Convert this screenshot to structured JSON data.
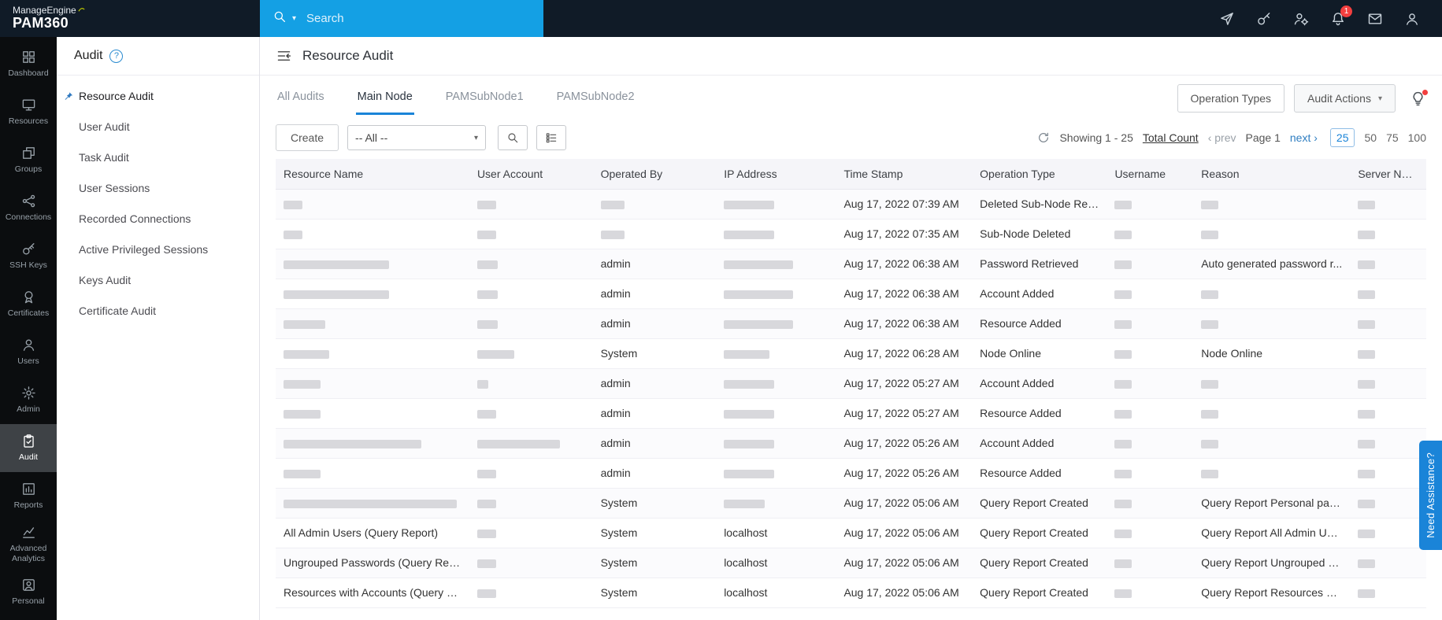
{
  "topbar": {
    "brand_line1": "ManageEngine",
    "brand_line2": "PAM360",
    "search": {
      "placeholder": "Search"
    },
    "icons": [
      {
        "id": "quick-send",
        "icon": "send-icon"
      },
      {
        "id": "resource-key",
        "icon": "key-icon"
      },
      {
        "id": "user-settings",
        "icon": "user-settings-icon"
      },
      {
        "id": "notifications",
        "icon": "bell-icon",
        "badge": "1"
      },
      {
        "id": "mail",
        "icon": "mail-icon"
      },
      {
        "id": "profile",
        "icon": "profile-icon"
      }
    ]
  },
  "sidebar": {
    "items": [
      {
        "id": "dashboard",
        "label": "Dashboard",
        "icon": "dashboard-icon",
        "active": false
      },
      {
        "id": "resources",
        "label": "Resources",
        "icon": "resources-icon",
        "active": false
      },
      {
        "id": "groups",
        "label": "Groups",
        "icon": "groups-icon",
        "active": false
      },
      {
        "id": "connections",
        "label": "Connections",
        "icon": "connections-icon",
        "active": false
      },
      {
        "id": "ssh-keys",
        "label": "SSH Keys",
        "icon": "ssh-keys-icon",
        "active": false
      },
      {
        "id": "certificates",
        "label": "Certificates",
        "icon": "certificates-icon",
        "active": false
      },
      {
        "id": "users",
        "label": "Users",
        "icon": "users-icon",
        "active": false
      },
      {
        "id": "admin",
        "label": "Admin",
        "icon": "admin-icon",
        "active": false
      },
      {
        "id": "audit",
        "label": "Audit",
        "icon": "audit-icon",
        "active": true
      },
      {
        "id": "reports",
        "label": "Reports",
        "icon": "reports-icon",
        "active": false
      },
      {
        "id": "advanced-analytics",
        "label": "Advanced Analytics",
        "icon": "analytics-icon",
        "active": false
      },
      {
        "id": "personal",
        "label": "Personal",
        "icon": "personal-icon",
        "active": false
      }
    ]
  },
  "subsidebar": {
    "title": "Audit",
    "items": [
      {
        "id": "resource-audit",
        "label": "Resource Audit",
        "active": true,
        "pinned": true
      },
      {
        "id": "user-audit",
        "label": "User Audit",
        "active": false,
        "pinned": false
      },
      {
        "id": "task-audit",
        "label": "Task Audit",
        "active": false,
        "pinned": false
      },
      {
        "id": "user-sessions",
        "label": "User Sessions",
        "active": false,
        "pinned": false
      },
      {
        "id": "recorded-connections",
        "label": "Recorded Connections",
        "active": false,
        "pinned": false
      },
      {
        "id": "active-privileged-sessions",
        "label": "Active Privileged Sessions",
        "active": false,
        "pinned": false
      },
      {
        "id": "keys-audit",
        "label": "Keys Audit",
        "active": false,
        "pinned": false
      },
      {
        "id": "certificate-audit",
        "label": "Certificate Audit",
        "active": false,
        "pinned": false
      }
    ]
  },
  "main": {
    "page_title": "Resource Audit",
    "tabs": [
      {
        "id": "all-audits",
        "label": "All Audits",
        "active": false
      },
      {
        "id": "main-node",
        "label": "Main Node",
        "active": true
      },
      {
        "id": "pamsubnode1",
        "label": "PAMSubNode1",
        "active": false
      },
      {
        "id": "pamsubnode2",
        "label": "PAMSubNode2",
        "active": false
      }
    ],
    "buttons": {
      "operation_types": "Operation Types",
      "audit_actions": "Audit Actions"
    },
    "toolbar": {
      "create": "Create",
      "filter_selected": "-- All --"
    },
    "pagination": {
      "showing": "Showing 1 - 25",
      "total_count": "Total Count",
      "prev": "prev",
      "page": "Page 1",
      "next": "next",
      "sizes": [
        "25",
        "50",
        "75",
        "100"
      ],
      "active_size": "25"
    },
    "table": {
      "columns": [
        "Resource Name",
        "User Account",
        "Operated By",
        "IP Address",
        "Time Stamp",
        "Operation Type",
        "Username",
        "Reason",
        "Server Name"
      ],
      "rows": [
        [
          {
            "redacted": 24
          },
          {
            "redacted": 24
          },
          {
            "redacted": 30
          },
          {
            "redacted": 64
          },
          {
            "text": "Aug 17, 2022 07:39 AM"
          },
          {
            "text": "Deleted Sub-Node Rest..."
          },
          {
            "redacted": 22
          },
          {
            "redacted": 22
          },
          {
            "redacted": 22
          }
        ],
        [
          {
            "redacted": 24
          },
          {
            "redacted": 24
          },
          {
            "redacted": 30
          },
          {
            "redacted": 64
          },
          {
            "text": "Aug 17, 2022 07:35 AM"
          },
          {
            "text": "Sub-Node Deleted"
          },
          {
            "redacted": 22
          },
          {
            "redacted": 22
          },
          {
            "redacted": 22
          }
        ],
        [
          {
            "redacted": 134
          },
          {
            "redacted": 26
          },
          {
            "text": "admin"
          },
          {
            "redacted": 88
          },
          {
            "text": "Aug 17, 2022 06:38 AM"
          },
          {
            "text": "Password Retrieved"
          },
          {
            "redacted": 22
          },
          {
            "text": "Auto generated password r..."
          },
          {
            "redacted": 22
          }
        ],
        [
          {
            "redacted": 134
          },
          {
            "redacted": 26
          },
          {
            "text": "admin"
          },
          {
            "redacted": 88
          },
          {
            "text": "Aug 17, 2022 06:38 AM"
          },
          {
            "text": "Account Added"
          },
          {
            "redacted": 22
          },
          {
            "redacted": 22
          },
          {
            "redacted": 22
          }
        ],
        [
          {
            "redacted": 53
          },
          {
            "redacted": 26
          },
          {
            "text": "admin"
          },
          {
            "redacted": 88
          },
          {
            "text": "Aug 17, 2022 06:38 AM"
          },
          {
            "text": "Resource Added"
          },
          {
            "redacted": 22
          },
          {
            "redacted": 22
          },
          {
            "redacted": 22
          }
        ],
        [
          {
            "redacted": 58
          },
          {
            "redacted": 47
          },
          {
            "text": "System"
          },
          {
            "redacted": 58
          },
          {
            "text": "Aug 17, 2022 06:28 AM"
          },
          {
            "text": "Node Online"
          },
          {
            "redacted": 22
          },
          {
            "text": "Node Online"
          },
          {
            "redacted": 22
          }
        ],
        [
          {
            "redacted": 47
          },
          {
            "redacted": 14
          },
          {
            "text": "admin"
          },
          {
            "redacted": 64
          },
          {
            "text": "Aug 17, 2022 05:27 AM"
          },
          {
            "text": "Account Added"
          },
          {
            "redacted": 22
          },
          {
            "redacted": 22
          },
          {
            "redacted": 22
          }
        ],
        [
          {
            "redacted": 47
          },
          {
            "redacted": 24
          },
          {
            "text": "admin"
          },
          {
            "redacted": 64
          },
          {
            "text": "Aug 17, 2022 05:27 AM"
          },
          {
            "text": "Resource Added"
          },
          {
            "redacted": 22
          },
          {
            "redacted": 22
          },
          {
            "redacted": 22
          }
        ],
        [
          {
            "redacted": 175
          },
          {
            "redacted": 105
          },
          {
            "text": "admin"
          },
          {
            "redacted": 64
          },
          {
            "text": "Aug 17, 2022 05:26 AM"
          },
          {
            "text": "Account Added"
          },
          {
            "redacted": 22
          },
          {
            "redacted": 22
          },
          {
            "redacted": 22
          }
        ],
        [
          {
            "redacted": 47
          },
          {
            "redacted": 24
          },
          {
            "text": "admin"
          },
          {
            "redacted": 64
          },
          {
            "text": "Aug 17, 2022 05:26 AM"
          },
          {
            "text": "Resource Added"
          },
          {
            "redacted": 22
          },
          {
            "redacted": 22
          },
          {
            "redacted": 22
          }
        ],
        [
          {
            "redacted": 220
          },
          {
            "redacted": 24
          },
          {
            "text": "System"
          },
          {
            "redacted": 52
          },
          {
            "text": "Aug 17, 2022 05:06 AM"
          },
          {
            "text": "Query Report Created"
          },
          {
            "redacted": 22
          },
          {
            "text": "Query Report Personal pass..."
          },
          {
            "redacted": 22
          }
        ],
        [
          {
            "text": "All Admin Users (Query Report)"
          },
          {
            "redacted": 24
          },
          {
            "text": "System"
          },
          {
            "text": "localhost"
          },
          {
            "text": "Aug 17, 2022 05:06 AM"
          },
          {
            "text": "Query Report Created"
          },
          {
            "redacted": 22
          },
          {
            "text": "Query Report All Admin Use..."
          },
          {
            "redacted": 22
          }
        ],
        [
          {
            "text": "Ungrouped Passwords (Query Report)"
          },
          {
            "redacted": 24
          },
          {
            "text": "System"
          },
          {
            "text": "localhost"
          },
          {
            "text": "Aug 17, 2022 05:06 AM"
          },
          {
            "text": "Query Report Created"
          },
          {
            "redacted": 22
          },
          {
            "text": "Query Report Ungrouped P..."
          },
          {
            "redacted": 22
          }
        ],
        [
          {
            "text": "Resources with Accounts (Query Re..."
          },
          {
            "redacted": 24
          },
          {
            "text": "System"
          },
          {
            "text": "localhost"
          },
          {
            "text": "Aug 17, 2022 05:06 AM"
          },
          {
            "text": "Query Report Created"
          },
          {
            "redacted": 22
          },
          {
            "text": "Query Report Resources wit..."
          },
          {
            "redacted": 22
          }
        ]
      ]
    }
  },
  "assist": {
    "label": "Need Assistance?"
  },
  "colors": {
    "accent_blue": "#1a84d8",
    "search_blue": "#14a0e4",
    "badge_red": "#f23f3f",
    "topbar_bg": "#101b27",
    "sidebar_bg": "#0b0d0f"
  }
}
